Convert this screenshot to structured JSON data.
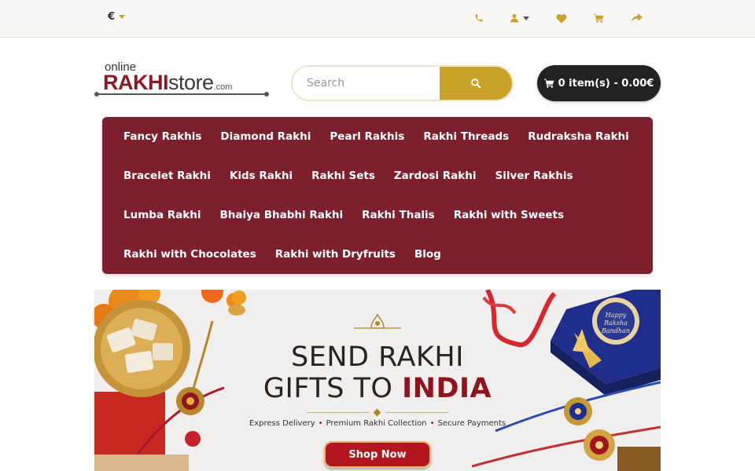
{
  "topbar": {
    "currency_symbol": "€",
    "icons": [
      "phone-icon",
      "user-icon",
      "heart-icon",
      "cart-icon",
      "share-icon"
    ],
    "icon_color": "#c9a227"
  },
  "logo": {
    "online": "online",
    "rakhi": "RAKHI",
    "store": "store",
    "com": ".com"
  },
  "search": {
    "placeholder": "Search"
  },
  "cart": {
    "label": "0 item(s) - 0.00€"
  },
  "nav": {
    "rows": [
      [
        "Fancy Rakhis",
        "Diamond Rakhi",
        "Pearl Rakhis",
        "Rakhi Threads",
        "Rudraksha Rakhi"
      ],
      [
        "Bracelet Rakhi",
        "Kids Rakhi",
        "Rakhi Sets",
        "Zardosi Rakhi",
        "Silver Rakhis"
      ],
      [
        "Lumba Rakhi",
        "Bhaiya Bhabhi Rakhi",
        "Rakhi Thalis",
        "Rakhi with Sweets"
      ],
      [
        "Rakhi with Chocolates",
        "Rakhi with Dryfruits",
        "Blog"
      ]
    ]
  },
  "banner": {
    "line1": "SEND RAKHI",
    "line2_prefix": "GIFTS TO ",
    "line2_highlight": "INDIA",
    "features": [
      "Express Delivery",
      "Premium Rakhi Collection",
      "Secure Payments"
    ],
    "cta": "Shop Now",
    "box_text": "Happy Raksha Bandhan"
  },
  "colors": {
    "brand_maroon": "#7d1f2c",
    "gold": "#c9a227",
    "cart_bg": "#222222"
  }
}
